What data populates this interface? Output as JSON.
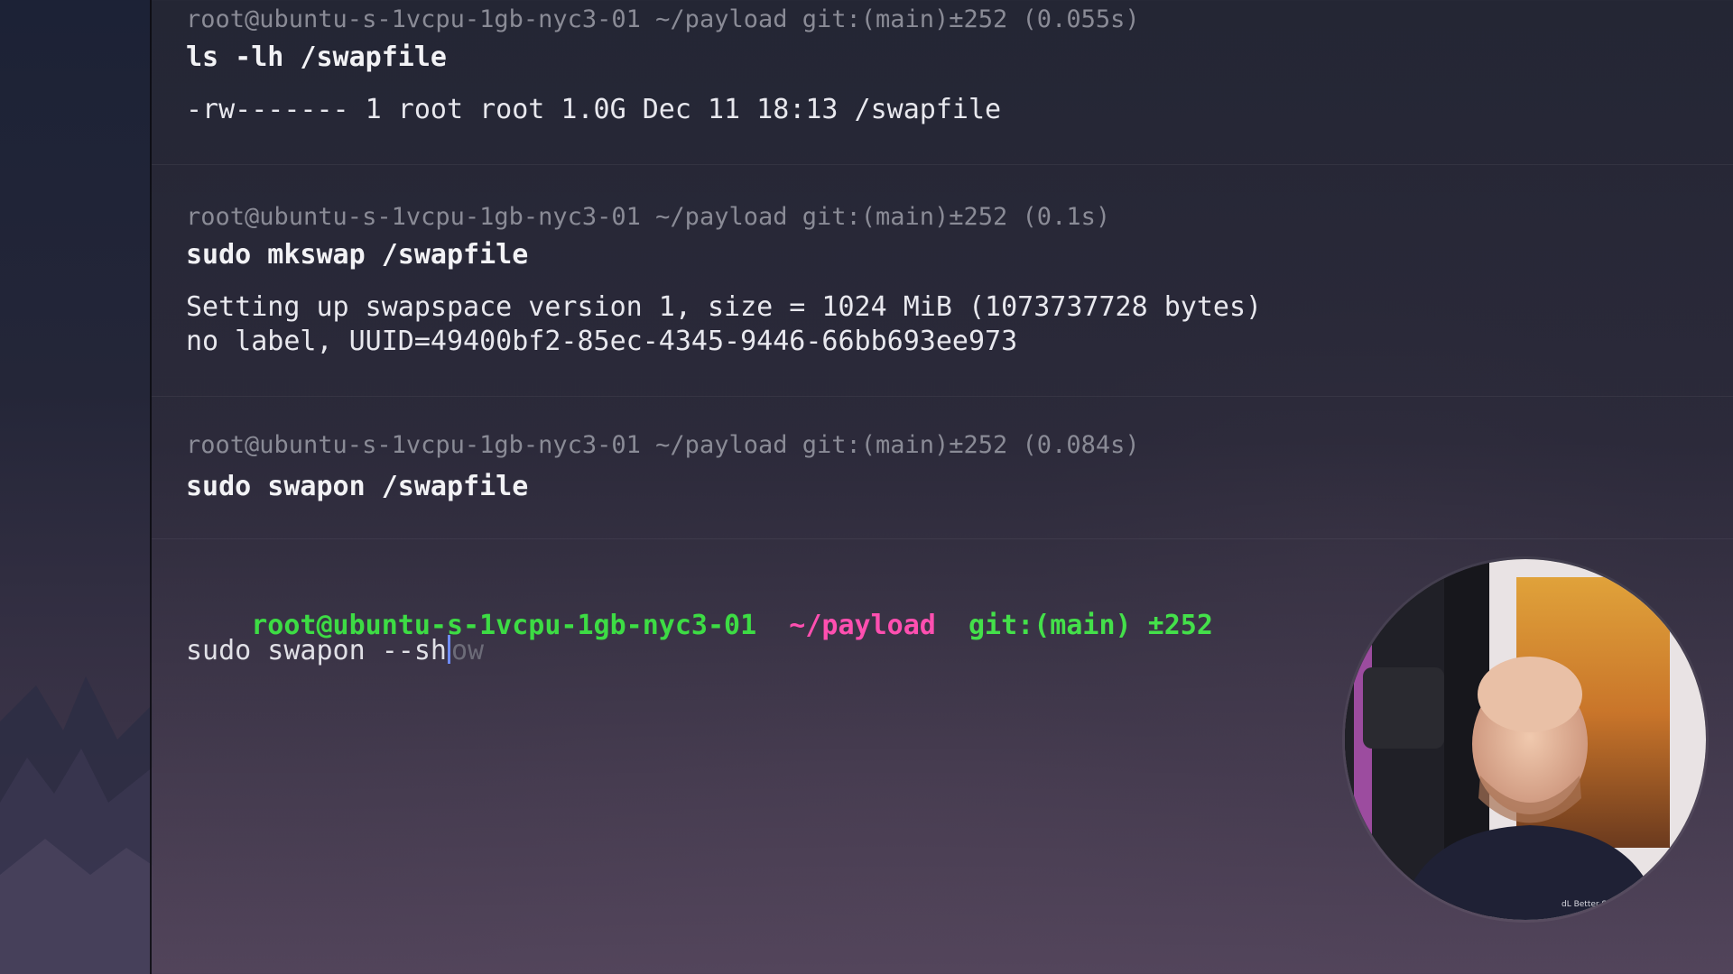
{
  "terminal": {
    "blocks": [
      {
        "prompt": "root@ubuntu-s-1vcpu-1gb-nyc3-01 ~/payload git:(main)±252 (0.055s)",
        "command": "ls -lh /swapfile",
        "output": [
          "-rw------- 1 root root 1.0G Dec 11 18:13 /swapfile"
        ]
      },
      {
        "prompt": "root@ubuntu-s-1vcpu-1gb-nyc3-01 ~/payload git:(main)±252 (0.1s)",
        "command": "sudo mkswap /swapfile",
        "output": [
          "Setting up swapspace version 1, size = 1024 MiB (1073737728 bytes)",
          "no label, UUID=49400bf2-85ec-4345-9446-66bb693ee973"
        ]
      },
      {
        "prompt": "root@ubuntu-s-1vcpu-1gb-nyc3-01 ~/payload git:(main)±252 (0.084s)",
        "command": "sudo swapon /swapfile",
        "output": []
      }
    ],
    "active": {
      "host": "root@ubuntu-s-1vcpu-1gb-nyc3-01",
      "path": "~/payload",
      "git": "git:(main) ±252",
      "typed": "sudo swapon --sh",
      "suggestion": "ow"
    }
  },
  "colors": {
    "host": "#3ddc44",
    "path": "#ff4fb0",
    "git": "#44e04a",
    "cursor": "#6f8cff"
  },
  "webcam": {
    "icon": "presenter-webcam-overlay"
  }
}
